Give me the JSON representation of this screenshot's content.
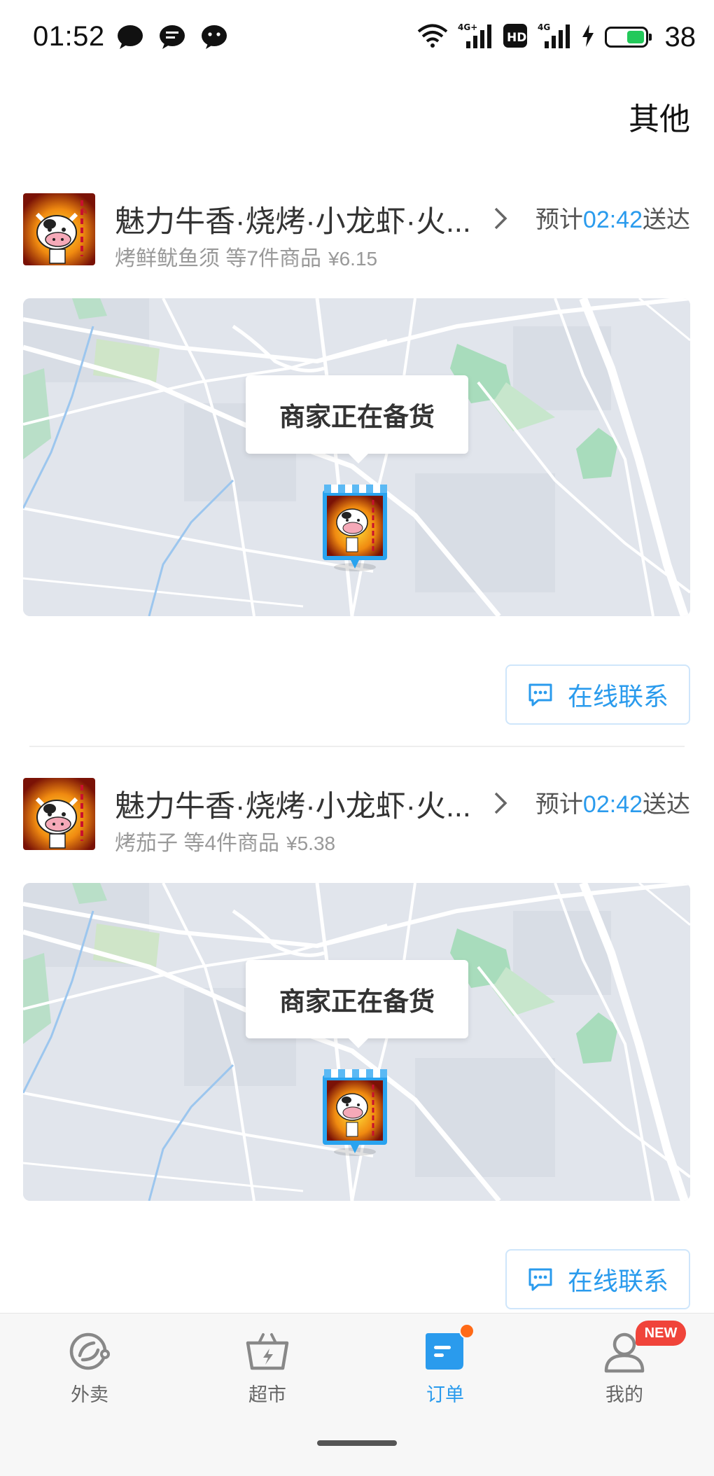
{
  "status_bar": {
    "time": "01:52",
    "notification_icons": [
      "chat-bubble-icon",
      "message-icon",
      "wechat-icon"
    ],
    "system_icons": [
      "wifi-icon",
      "signal-4g-plus-icon",
      "hd-icon",
      "signal-4g-icon",
      "charging-icon"
    ],
    "battery_level": "38",
    "battery_color": "#23c95a"
  },
  "header": {
    "other_label": "其他"
  },
  "orders": [
    {
      "shop_name": "魅力牛香·烧烤·小龙虾·火...",
      "items_summary": "烤鲜鱿鱼须 等7件商品",
      "price": "¥6.15",
      "eta_prefix": "预计",
      "eta_time": "02:42",
      "eta_suffix": "送达",
      "map_status": "商家正在备货",
      "contact_label": "在线联系"
    },
    {
      "shop_name": "魅力牛香·烧烤·小龙虾·火...",
      "items_summary": "烤茄子 等4件商品",
      "price": "¥5.38",
      "eta_prefix": "预计",
      "eta_time": "02:42",
      "eta_suffix": "送达",
      "map_status": "商家正在备货",
      "contact_label": "在线联系"
    }
  ],
  "tab_bar": {
    "tabs": [
      {
        "label": "外卖",
        "icon": "takeout-icon",
        "active": false
      },
      {
        "label": "超市",
        "icon": "supermarket-basket-icon",
        "active": false
      },
      {
        "label": "订单",
        "icon": "orders-icon",
        "active": true,
        "badge": "dot"
      },
      {
        "label": "我的",
        "icon": "profile-icon",
        "active": false,
        "badge": "NEW"
      }
    ]
  },
  "colors": {
    "accent": "#2a9bed",
    "badge_orange": "#ff6a17",
    "badge_red": "#f0443a"
  }
}
